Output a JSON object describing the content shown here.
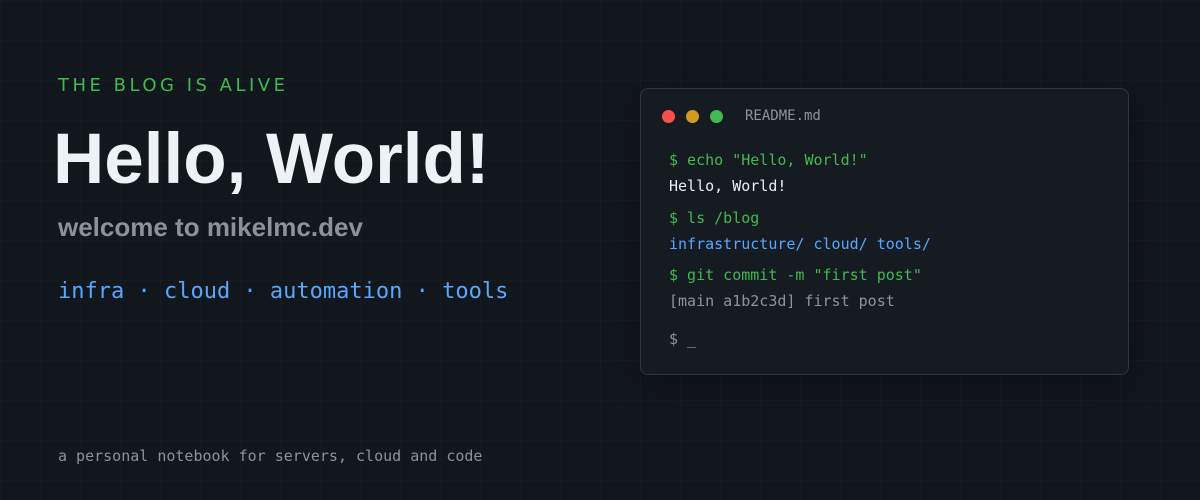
{
  "hero": {
    "eyebrow": "THE BLOG IS ALIVE",
    "headline": "Hello, World!",
    "welcome": "welcome to mikelmc.dev",
    "tagline": "infra · cloud · automation · tools",
    "footer_note": "a personal notebook for servers, cloud and code"
  },
  "terminal": {
    "title": "README.md",
    "window_controls": [
      "close",
      "minimize",
      "maximize"
    ],
    "lines": [
      {
        "kind": "command",
        "text": "$ echo \"Hello, World!\""
      },
      {
        "kind": "output",
        "text": "Hello, World!"
      },
      {
        "kind": "command",
        "text": "$ ls /blog"
      },
      {
        "kind": "output",
        "text": "infrastructure/ cloud/ tools/"
      },
      {
        "kind": "command",
        "text": "$ git commit -m \"first post\""
      },
      {
        "kind": "output",
        "text": "[main a1b2c3d] first post"
      },
      {
        "kind": "prompt",
        "text": "$ _"
      }
    ]
  },
  "colors": {
    "background": "#12161d",
    "accent_green": "#3fb950",
    "accent_blue": "#58a6ff",
    "headline": "#eef1f6",
    "muted": "#8b929c",
    "terminal_bg": "#161b22",
    "dot_red": "#f85149",
    "dot_yellow": "#d29922",
    "dot_green": "#3fb950"
  }
}
